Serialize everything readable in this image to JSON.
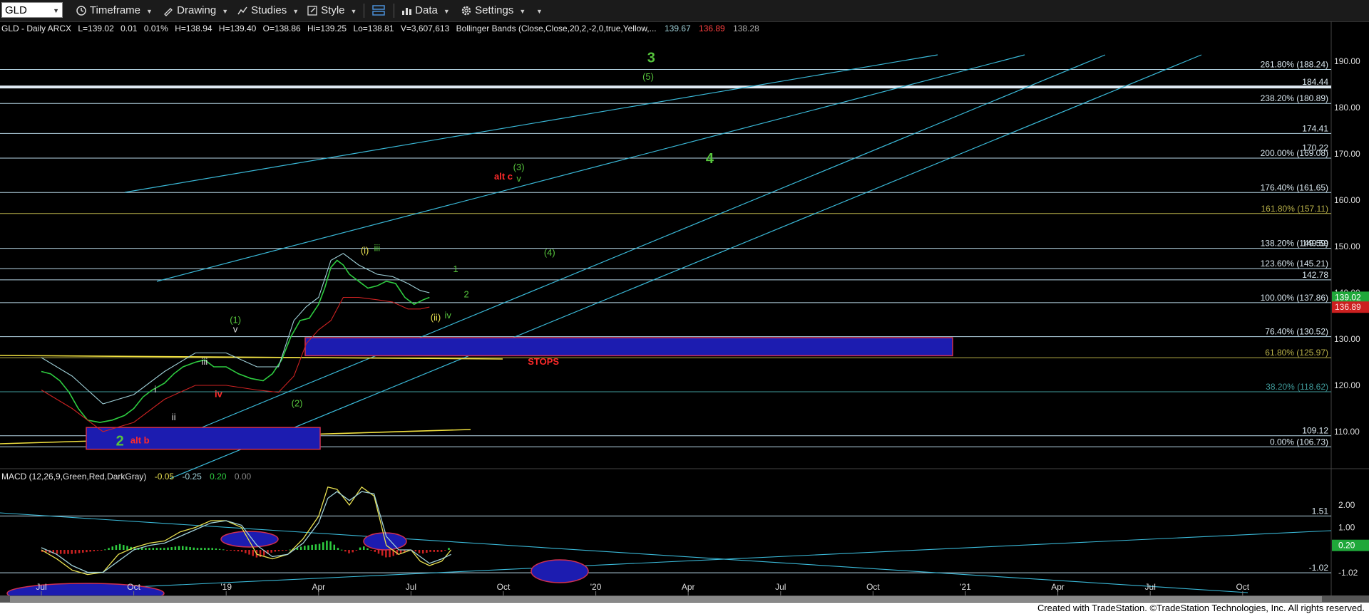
{
  "toolbar": {
    "symbol": "GLD",
    "timeframe_label": "Timeframe",
    "drawing_label": "Drawing",
    "studies_label": "Studies",
    "style_label": "Style",
    "data_label": "Data",
    "settings_label": "Settings"
  },
  "price_header": {
    "title": "GLD - Daily  ARCX",
    "last": "L=139.02",
    "change": "0.01",
    "change_pct": "0.01%",
    "high_label": "H=138.94",
    "hi_value": "H=139.40",
    "open": "O=138.86",
    "hi": "Hi=139.25",
    "lo": "Lo=138.81",
    "volume": "V=3,607,613",
    "bb_label": "Bollinger Bands (Close,Close,20,2,-2,0,true,Yellow,...",
    "bb_upper": "139.67",
    "bb_lower": "136.89",
    "bb_mid": "138.28"
  },
  "macd_header": {
    "label": "MACD (12,26,9,Green,Red,DarkGray)",
    "macd": "-0.05",
    "signal": "-0.25",
    "hist": "0.20",
    "zero": "0.00"
  },
  "footer_text": "Created with TradeStation. ©TradeStation Technologies, Inc. All rights reserved.",
  "colors": {
    "price": "#2ecc40",
    "bb_upper": "#9fd0d8",
    "bb_lower": "#cc2222",
    "fib_line": "#b8d8e8",
    "fib_yellow": "#b8b048",
    "fib_teal": "#3f9a9a",
    "channel": "#3ab9d8",
    "wave_green": "#56c43c",
    "wave_red": "#ff2a2a",
    "wave_yellow": "#e8e050",
    "wave_white": "#e0e0e0",
    "box_fill": "#1c1cb0",
    "box_edge": "#d03050"
  },
  "chart_data": [
    {
      "type": "line",
      "title": "GLD - Daily ARCX",
      "y_axis": {
        "ticks": [
          110.0,
          120.0,
          130.0,
          140.0,
          150.0,
          160.0,
          170.0,
          180.0,
          190.0
        ],
        "ylim": [
          104,
          194
        ]
      },
      "x_axis": {
        "ticks": [
          "Jul",
          "Oct",
          "'19",
          "Apr",
          "Jul",
          "Oct",
          "'20",
          "Apr",
          "Jul",
          "Oct",
          "'21",
          "Apr",
          "Jul",
          "Oct"
        ]
      },
      "series": [
        {
          "name": "GLD",
          "color": "#2ecc40",
          "points": [
            [
              0,
              123.0
            ],
            [
              0.3,
              122.5
            ],
            [
              0.6,
              121.0
            ],
            [
              0.9,
              118.5
            ],
            [
              1.2,
              115.0
            ],
            [
              1.5,
              112.5
            ],
            [
              1.9,
              112.0
            ],
            [
              2.3,
              112.5
            ],
            [
              2.7,
              113.5
            ],
            [
              3.0,
              115.0
            ],
            [
              3.3,
              117.5
            ],
            [
              3.6,
              119.0
            ],
            [
              4.0,
              120.5
            ],
            [
              4.3,
              122.5
            ],
            [
              4.6,
              124.0
            ],
            [
              5.0,
              125.0
            ],
            [
              5.3,
              125.5
            ],
            [
              5.6,
              124.0
            ],
            [
              6.0,
              124.0
            ],
            [
              6.4,
              122.5
            ],
            [
              6.8,
              121.5
            ],
            [
              7.2,
              121.0
            ],
            [
              7.5,
              122.5
            ],
            [
              7.8,
              125.5
            ],
            [
              8.1,
              130.5
            ],
            [
              8.4,
              134.0
            ],
            [
              8.7,
              134.5
            ],
            [
              9.0,
              137.5
            ],
            [
              9.2,
              141.0
            ],
            [
              9.4,
              145.5
            ],
            [
              9.6,
              147.0
            ],
            [
              9.8,
              146.0
            ],
            [
              10.0,
              144.0
            ],
            [
              10.3,
              142.5
            ],
            [
              10.6,
              141.0
            ],
            [
              10.9,
              141.5
            ],
            [
              11.2,
              142.5
            ],
            [
              11.5,
              142.0
            ],
            [
              11.8,
              139.0
            ],
            [
              12.1,
              137.5
            ],
            [
              12.4,
              138.5
            ],
            [
              12.6,
              139.0
            ]
          ]
        },
        {
          "name": "BB upper",
          "color": "#9fd0d8",
          "points": [
            [
              0,
              126
            ],
            [
              1,
              122
            ],
            [
              2,
              116
            ],
            [
              3,
              118
            ],
            [
              4,
              123
            ],
            [
              5,
              127
            ],
            [
              6,
              127
            ],
            [
              7,
              124
            ],
            [
              7.7,
              124
            ],
            [
              8.2,
              134
            ],
            [
              8.6,
              137
            ],
            [
              9.0,
              139
            ],
            [
              9.4,
              147
            ],
            [
              9.8,
              148.5
            ],
            [
              10.3,
              146
            ],
            [
              10.9,
              144
            ],
            [
              11.4,
              143.5
            ],
            [
              11.9,
              142
            ],
            [
              12.3,
              140.5
            ],
            [
              12.6,
              140
            ]
          ]
        },
        {
          "name": "BB lower",
          "color": "#cc2222",
          "points": [
            [
              0,
              119
            ],
            [
              1,
              115
            ],
            [
              2,
              110
            ],
            [
              3,
              112
            ],
            [
              4,
              117
            ],
            [
              5,
              120
            ],
            [
              6,
              120
            ],
            [
              7,
              119
            ],
            [
              7.7,
              118.5
            ],
            [
              8.2,
              122
            ],
            [
              8.6,
              129
            ],
            [
              9.0,
              132
            ],
            [
              9.4,
              134
            ],
            [
              9.8,
              139
            ],
            [
              10.3,
              139
            ],
            [
              10.9,
              138.5
            ],
            [
              11.4,
              138
            ],
            [
              11.9,
              136.5
            ],
            [
              12.3,
              136.5
            ],
            [
              12.6,
              136.9
            ]
          ]
        }
      ],
      "reference_levels": [
        {
          "label": "261.80% (188.24)",
          "value": 188.24
        },
        {
          "label": "184.44",
          "value": 184.44
        },
        {
          "label": "238.20% (180.89)",
          "value": 180.89
        },
        {
          "label": "174.41",
          "value": 174.41
        },
        {
          "label": "170.22",
          "value": 170.22
        },
        {
          "label": "200.00% (169.08)",
          "value": 169.08
        },
        {
          "label": "176.40% (161.65)",
          "value": 161.65
        },
        {
          "label": "161.80% (157.11)",
          "value": 157.11
        },
        {
          "label": "138.20% (149.59)",
          "value": 149.59
        },
        {
          "label": "149.59",
          "value": 149.59
        },
        {
          "label": "123.60% (145.21)",
          "value": 145.21
        },
        {
          "label": "142.78",
          "value": 142.78
        },
        {
          "label": "100.00% (137.86)",
          "value": 137.86
        },
        {
          "label": "76.40% (130.52)",
          "value": 130.52
        },
        {
          "label": "61.80% (125.97)",
          "value": 125.97
        },
        {
          "label": "38.20% (118.62)",
          "value": 118.62
        },
        {
          "label": "109.12",
          "value": 109.12
        },
        {
          "label": "0.00% (106.73)",
          "value": 106.73
        }
      ],
      "price_badges": [
        {
          "label": "139.02",
          "value": 139.02
        },
        {
          "label": "136.89",
          "value": 136.89
        }
      ],
      "annotations": [
        {
          "text": "3",
          "x": 19.8,
          "y": 189.8,
          "color": "green",
          "size": "large"
        },
        {
          "text": "(5)",
          "x": 19.7,
          "y": 186.0,
          "color": "green"
        },
        {
          "text": "4",
          "x": 21.7,
          "y": 168.0,
          "color": "green",
          "size": "large"
        },
        {
          "text": "alt c",
          "x": 15.0,
          "y": 164.5,
          "color": "red"
        },
        {
          "text": "(3)",
          "x": 15.5,
          "y": 166.5,
          "color": "green"
        },
        {
          "text": "v",
          "x": 15.5,
          "y": 164.0,
          "color": "green"
        },
        {
          "text": "(4)",
          "x": 16.5,
          "y": 148.0,
          "color": "green"
        },
        {
          "text": "(i)",
          "x": 10.5,
          "y": 148.5,
          "color": "yellow"
        },
        {
          "text": "iii",
          "x": 10.9,
          "y": 149.0,
          "color": "green"
        },
        {
          "text": "1",
          "x": 13.45,
          "y": 144.5,
          "color": "green"
        },
        {
          "text": "2",
          "x": 13.8,
          "y": 139.0,
          "color": "green"
        },
        {
          "text": "(ii)",
          "x": 12.8,
          "y": 134.0,
          "color": "yellow"
        },
        {
          "text": "iv",
          "x": 13.2,
          "y": 134.5,
          "color": "green"
        },
        {
          "text": "(1)",
          "x": 6.3,
          "y": 133.5,
          "color": "green"
        },
        {
          "text": "v",
          "x": 6.3,
          "y": 131.5,
          "color": "white"
        },
        {
          "text": "iii",
          "x": 5.3,
          "y": 124.5,
          "color": "white"
        },
        {
          "text": "i",
          "x": 3.7,
          "y": 118.5,
          "color": "white"
        },
        {
          "text": "iv",
          "x": 5.75,
          "y": 117.5,
          "color": "red"
        },
        {
          "text": "ii",
          "x": 4.3,
          "y": 112.5,
          "color": "white"
        },
        {
          "text": "(2)",
          "x": 8.3,
          "y": 115.5,
          "color": "green"
        },
        {
          "text": "2",
          "x": 2.55,
          "y": 107.0,
          "color": "green",
          "size": "large"
        },
        {
          "text": "alt b",
          "x": 3.2,
          "y": 107.5,
          "color": "red"
        },
        {
          "text": "STOPS",
          "x": 16.3,
          "y": 124.5,
          "color": "red"
        }
      ]
    },
    {
      "type": "line",
      "title": "MACD (12,26,9,Green,Red,DarkGray)",
      "y_axis": {
        "ticks": [
          2.0,
          1.0,
          0.2,
          -1.02
        ],
        "ylim": [
          -1.6,
          3.2
        ]
      },
      "reference_levels": [
        {
          "label": "1.51",
          "value": 1.51
        },
        {
          "label": "-1.02",
          "value": -1.02
        }
      ],
      "price_badges": [
        {
          "label": "0.20",
          "value": 0.2
        }
      ],
      "series": [
        {
          "name": "MACD",
          "color": "#e8e050",
          "points": [
            [
              0,
              0.0
            ],
            [
              0.5,
              -0.4
            ],
            [
              1,
              -0.9
            ],
            [
              1.5,
              -1.1
            ],
            [
              2,
              -1.0
            ],
            [
              2.5,
              -0.2
            ],
            [
              3,
              0.1
            ],
            [
              3.5,
              0.3
            ],
            [
              4,
              0.4
            ],
            [
              4.5,
              0.8
            ],
            [
              5,
              1.0
            ],
            [
              5.5,
              1.3
            ],
            [
              6,
              1.3
            ],
            [
              6.5,
              1.0
            ],
            [
              7,
              -0.2
            ],
            [
              7.5,
              -0.4
            ],
            [
              8,
              -0.2
            ],
            [
              8.5,
              0.5
            ],
            [
              9,
              1.5
            ],
            [
              9.3,
              2.8
            ],
            [
              9.6,
              2.7
            ],
            [
              10,
              2.0
            ],
            [
              10.4,
              2.8
            ],
            [
              10.8,
              2.4
            ],
            [
              11.2,
              0.2
            ],
            [
              11.6,
              -0.2
            ],
            [
              12,
              0.0
            ],
            [
              12.3,
              -0.5
            ],
            [
              12.6,
              -0.7
            ],
            [
              13,
              -0.5
            ],
            [
              13.3,
              0.0
            ]
          ]
        },
        {
          "name": "Signal",
          "color": "#9fd0d8",
          "points": [
            [
              0,
              0.1
            ],
            [
              0.5,
              -0.2
            ],
            [
              1,
              -0.7
            ],
            [
              1.5,
              -1.0
            ],
            [
              2,
              -1.0
            ],
            [
              2.5,
              -0.5
            ],
            [
              3,
              0.0
            ],
            [
              3.5,
              0.2
            ],
            [
              4,
              0.3
            ],
            [
              4.5,
              0.6
            ],
            [
              5,
              0.9
            ],
            [
              5.5,
              1.2
            ],
            [
              6,
              1.3
            ],
            [
              6.5,
              1.1
            ],
            [
              7,
              0.2
            ],
            [
              7.5,
              -0.3
            ],
            [
              8,
              -0.2
            ],
            [
              8.5,
              0.3
            ],
            [
              9,
              1.2
            ],
            [
              9.3,
              2.3
            ],
            [
              9.6,
              2.6
            ],
            [
              10,
              2.2
            ],
            [
              10.4,
              2.6
            ],
            [
              10.8,
              2.5
            ],
            [
              11.2,
              0.6
            ],
            [
              11.6,
              0.0
            ],
            [
              12,
              0.0
            ],
            [
              12.3,
              -0.3
            ],
            [
              12.6,
              -0.6
            ],
            [
              13,
              -0.4
            ],
            [
              13.3,
              -0.2
            ]
          ]
        }
      ]
    }
  ]
}
